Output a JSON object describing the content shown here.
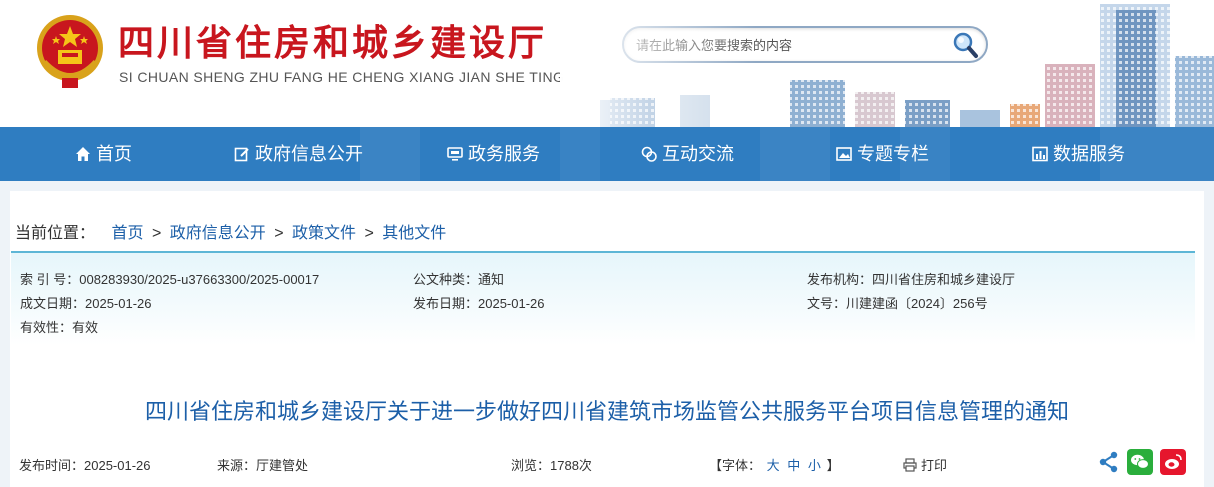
{
  "header": {
    "site_title": "四川省住房和城乡建设厅",
    "site_pinyin": "SI CHUAN SHENG ZHU FANG HE CHENG XIANG JIAN SHE TING",
    "search_placeholder": "请在此输入您要搜索的内容",
    "emblem_icon": "national-emblem-icon",
    "search_icon": "magnifier-icon"
  },
  "nav": {
    "items": [
      {
        "label": "首页",
        "icon": "home-icon"
      },
      {
        "label": "政府信息公开",
        "icon": "edit-icon"
      },
      {
        "label": "政务服务",
        "icon": "monitor-icon"
      },
      {
        "label": "互动交流",
        "icon": "chat-icon"
      },
      {
        "label": "专题专栏",
        "icon": "picture-icon"
      },
      {
        "label": "数据服务",
        "icon": "chart-icon"
      }
    ]
  },
  "breadcrumb": {
    "prefix": "当前位置：",
    "items": [
      "首页",
      "政府信息公开",
      "政策文件",
      "其他文件"
    ],
    "separator": ">"
  },
  "meta": {
    "index_label": "索 引 号：",
    "index_value": "008283930/2025-u37663300/2025-00017",
    "category_label": "公文种类：",
    "category_value": "通知",
    "publisher_label": "发布机构：",
    "publisher_value": "四川省住房和城乡建设厅",
    "created_label": "成文日期：",
    "created_value": "2025-01-26",
    "published_label": "发布日期：",
    "published_value": "2025-01-26",
    "docno_label": "文号：",
    "docno_value": "川建建函〔2024〕256号",
    "validity_label": "有效性：",
    "validity_value": "有效"
  },
  "article": {
    "title": "四川省住房和城乡建设厅关于进一步做好四川省建筑市场监管公共服务平台项目信息管理的通知",
    "publish_time_label": "发布时间：",
    "publish_time_value": "2025-01-26",
    "source_label": "来源：",
    "source_value": "厅建管处",
    "views_label": "浏览：",
    "views_value": "1788次",
    "font_label": "【字体：",
    "font_large": "大",
    "font_medium": "中",
    "font_small": "小",
    "font_close": "】",
    "print_label": "打印",
    "share_icons": [
      "share-icon",
      "wechat-icon",
      "weibo-icon"
    ]
  },
  "colors": {
    "brand_red": "#c8161e",
    "nav_blue": "#2f7dc1",
    "link_blue": "#1c5fa8",
    "meta_border": "#5db6d6",
    "wechat_green": "#2aae3c",
    "weibo_red": "#e6162d"
  }
}
